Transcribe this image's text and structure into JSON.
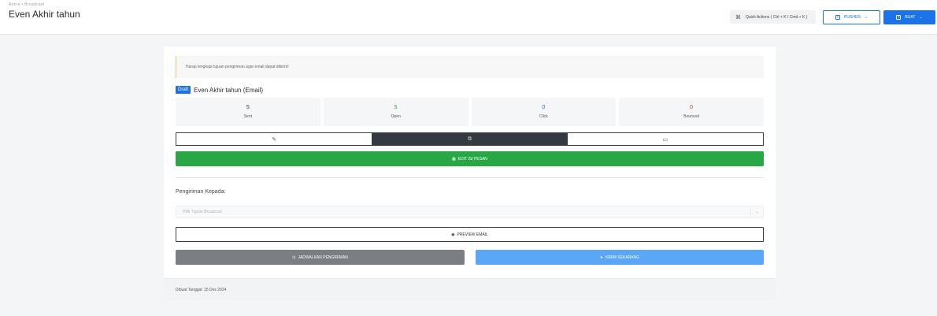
{
  "header": {
    "breadcrumb": "Antrie • Broadcast",
    "title": "Even Akhir tahun",
    "quick_actions": {
      "icon": "command-icon",
      "label": "Quick Actions ( Ctrl + K / Cmd + K )"
    },
    "pusher_button": {
      "icon": "plus-square-icon",
      "label": "PUSHER"
    },
    "buat_button": {
      "icon": "plus-square-icon",
      "label": "BUAT"
    }
  },
  "alert": {
    "text": "Harap lengkapi tujuan pengiriman agar email dapat dikirim!",
    "color": "#f0c36d"
  },
  "campaign": {
    "status_badge": "Draft",
    "title": "Even Akhir tahun (Email)"
  },
  "stats": [
    {
      "value": "5",
      "label": "Sent",
      "color": "#333333"
    },
    {
      "value": "5",
      "label": "Open",
      "color": "#28a745"
    },
    {
      "value": "0",
      "label": "Click",
      "color": "#1a73e8"
    },
    {
      "value": "0",
      "label": "Bounced",
      "color": "#dc3545"
    }
  ],
  "tabs": [
    {
      "icon": "edit-icon",
      "glyph": "✎",
      "active": false
    },
    {
      "icon": "copy-icon",
      "glyph": "⧉",
      "active": true
    },
    {
      "icon": "calendar-icon",
      "glyph": "▭",
      "active": false
    }
  ],
  "edit_button": {
    "icon": "table-icon",
    "label": "EDIT ISI PESAN"
  },
  "recipient": {
    "label": "Pengiriman Kepada:",
    "placeholder": "Pilih Tujuan Broadcast"
  },
  "preview_button": {
    "icon": "eye-icon",
    "label": "PREVIEW EMAIL"
  },
  "schedule_button": {
    "icon": "clock-icon",
    "label": "JADWALKAN PENGIRIMAN"
  },
  "send_button": {
    "icon": "send-icon",
    "label": "KIRIM SEKARANG"
  },
  "footer": {
    "text": "Dibuat Tanggal: 15 Des 2024"
  },
  "colors": {
    "primary": "#1a73e8",
    "success": "#28a745",
    "dark": "#343a40",
    "secondary": "#7b7e82",
    "light_primary": "#5aa6f7"
  }
}
